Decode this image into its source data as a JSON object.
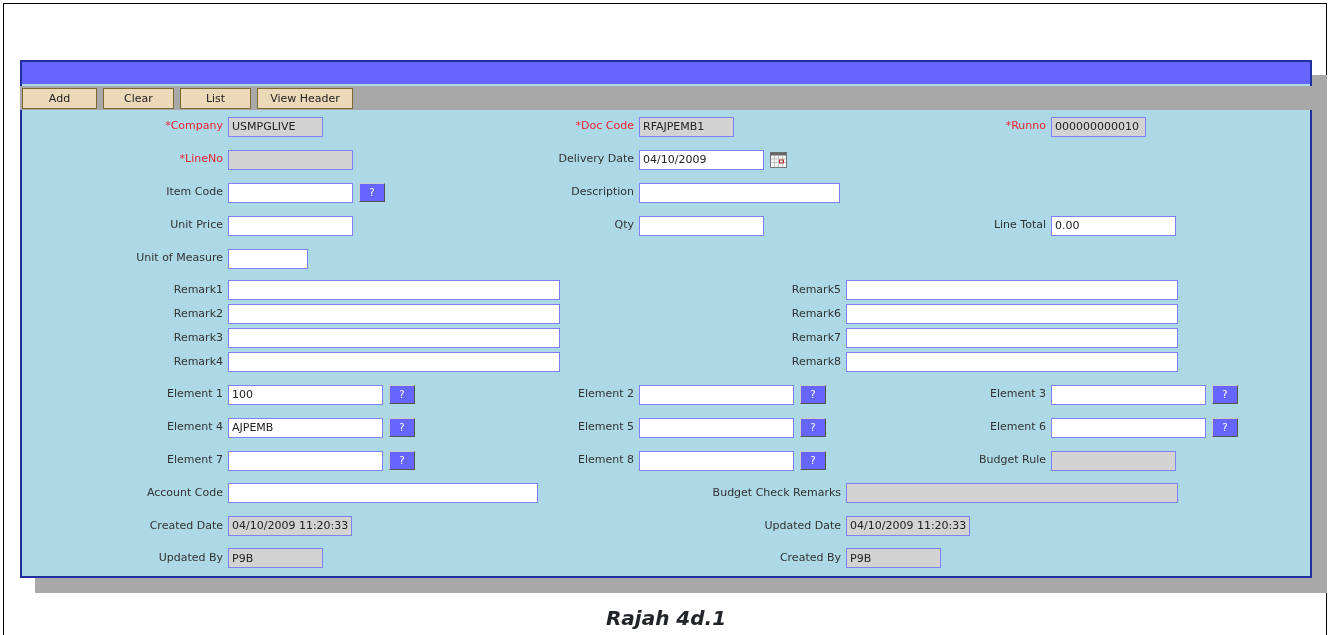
{
  "toolbar": {
    "buttons": [
      "Add",
      "Clear",
      "List",
      "View Header"
    ]
  },
  "rows": [
    {
      "kind": "triple",
      "left": {
        "label": "*Company",
        "value": "USMPGLIVE",
        "required": true,
        "readonly": true
      },
      "middle": {
        "label": "*Doc Code",
        "value": "RFAJPEMB1",
        "required": true,
        "readonly": true
      },
      "right": {
        "label": "*Runno",
        "value": "000000000010",
        "required": true,
        "readonly": true
      }
    },
    {
      "kind": "triple",
      "left": {
        "label": "*LineNo",
        "required": true,
        "readonly": true
      },
      "middle": {
        "label": "Delivery Date",
        "value": "04/10/2009",
        "required": false,
        "readonly": false,
        "calendar": true
      }
    },
    {
      "kind": "triple",
      "left": {
        "label": "Item Code",
        "required": false,
        "readonly": false,
        "lookup_button": "?"
      },
      "middle": {
        "label": "Description",
        "required": false,
        "readonly": false
      }
    },
    {
      "kind": "triple",
      "left": {
        "label": "Unit Price",
        "required": false,
        "readonly": false
      },
      "middle": {
        "label": "Qty",
        "required": false,
        "readonly": false
      },
      "right": {
        "label": "Line Total",
        "value": "0.00",
        "required": false,
        "readonly": false
      }
    },
    {
      "kind": "triple",
      "left": {
        "label": "Unit of Measure",
        "required": false,
        "readonly": false
      }
    },
    {
      "kind": "remark",
      "left": {
        "label": "Remark1",
        "required": false,
        "readonly": false
      },
      "right": {
        "label": "Remark5",
        "required": false,
        "readonly": false
      }
    },
    {
      "kind": "remark",
      "left": {
        "label": "Remark2",
        "required": false,
        "readonly": false
      },
      "right": {
        "label": "Remark6",
        "required": false,
        "readonly": false
      }
    },
    {
      "kind": "remark",
      "left": {
        "label": "Remark3",
        "required": false,
        "readonly": false
      },
      "right": {
        "label": "Remark7",
        "required": false,
        "readonly": false
      }
    },
    {
      "kind": "remark",
      "left": {
        "label": "Remark4",
        "required": false,
        "readonly": false
      },
      "right": {
        "label": "Remark8",
        "required": false,
        "readonly": false
      }
    },
    {
      "kind": "triple",
      "left": {
        "label": "Element 1",
        "value": "100",
        "required": false,
        "readonly": false,
        "lookup_button": "?"
      },
      "middle": {
        "label": "Element 2",
        "required": false,
        "readonly": false,
        "lookup_button": "?"
      },
      "right": {
        "label": "Element 3",
        "required": false,
        "readonly": false,
        "lookup_button": "?"
      }
    },
    {
      "kind": "triple",
      "left": {
        "label": "Element 4",
        "value": "AJPEMB",
        "required": false,
        "readonly": false,
        "lookup_button": "?"
      },
      "middle": {
        "label": "Element 5",
        "required": false,
        "readonly": false,
        "lookup_button": "?"
      },
      "right": {
        "label": "Element 6",
        "required": false,
        "readonly": false,
        "lookup_button": "?"
      }
    },
    {
      "kind": "triple",
      "left": {
        "label": "Element 7",
        "required": false,
        "readonly": false,
        "lookup_button": "?"
      },
      "middle": {
        "label": "Element 8",
        "required": false,
        "readonly": false,
        "lookup_button": "?"
      },
      "right": {
        "label": "Budget Rule",
        "required": false,
        "readonly": true
      }
    },
    {
      "kind": "pair",
      "left": {
        "label": "Account Code",
        "required": false,
        "readonly": false
      },
      "right": {
        "label": "Budget Check Remarks",
        "required": false,
        "readonly": true
      }
    },
    {
      "kind": "pair",
      "left": {
        "label": "Created Date",
        "value": "04/10/2009 11:20:33",
        "required": false,
        "readonly": true
      },
      "right": {
        "label": "Updated Date",
        "value": "04/10/2009 11:20:33",
        "required": false,
        "readonly": true
      }
    },
    {
      "kind": "pair",
      "left": {
        "label": "Updated By",
        "value": "P9B",
        "required": false,
        "readonly": true
      },
      "right": {
        "label": "Created By",
        "value": "P9B",
        "required": false,
        "readonly": true
      }
    }
  ],
  "caption": "Rajah 4d.1"
}
